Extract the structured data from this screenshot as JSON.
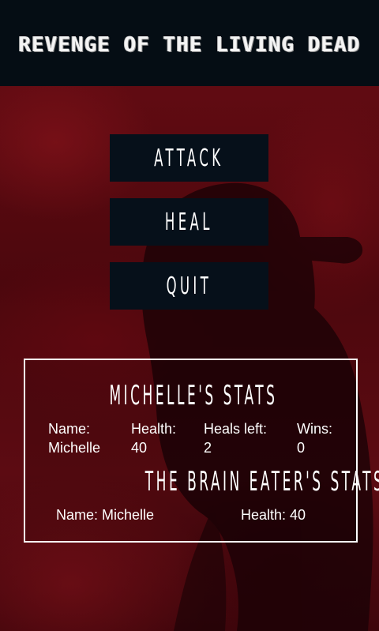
{
  "app": {
    "title": "REVENGE OF THE LIVING DEAD"
  },
  "menu": {
    "attack_label": "ATTACK",
    "heal_label": "HEAL",
    "quit_label": "QUIT"
  },
  "player_stats": {
    "heading": "MICHELLE'S STATS",
    "name_label": "Name:",
    "name_value": "Michelle",
    "health_label": "Health:",
    "health_value": "40",
    "heals_label": "Heals left:",
    "heals_value": "2",
    "wins_label": "Wins:",
    "wins_value": "0"
  },
  "enemy_stats": {
    "heading": "THE BRAIN EATER'S STATS",
    "name_text": "Name: Michelle",
    "health_text": "Health: 40"
  },
  "colors": {
    "header_bg": "#050d14",
    "button_bg": "#06101a",
    "background_red": "#5a0a10",
    "text": "#ffffff"
  }
}
